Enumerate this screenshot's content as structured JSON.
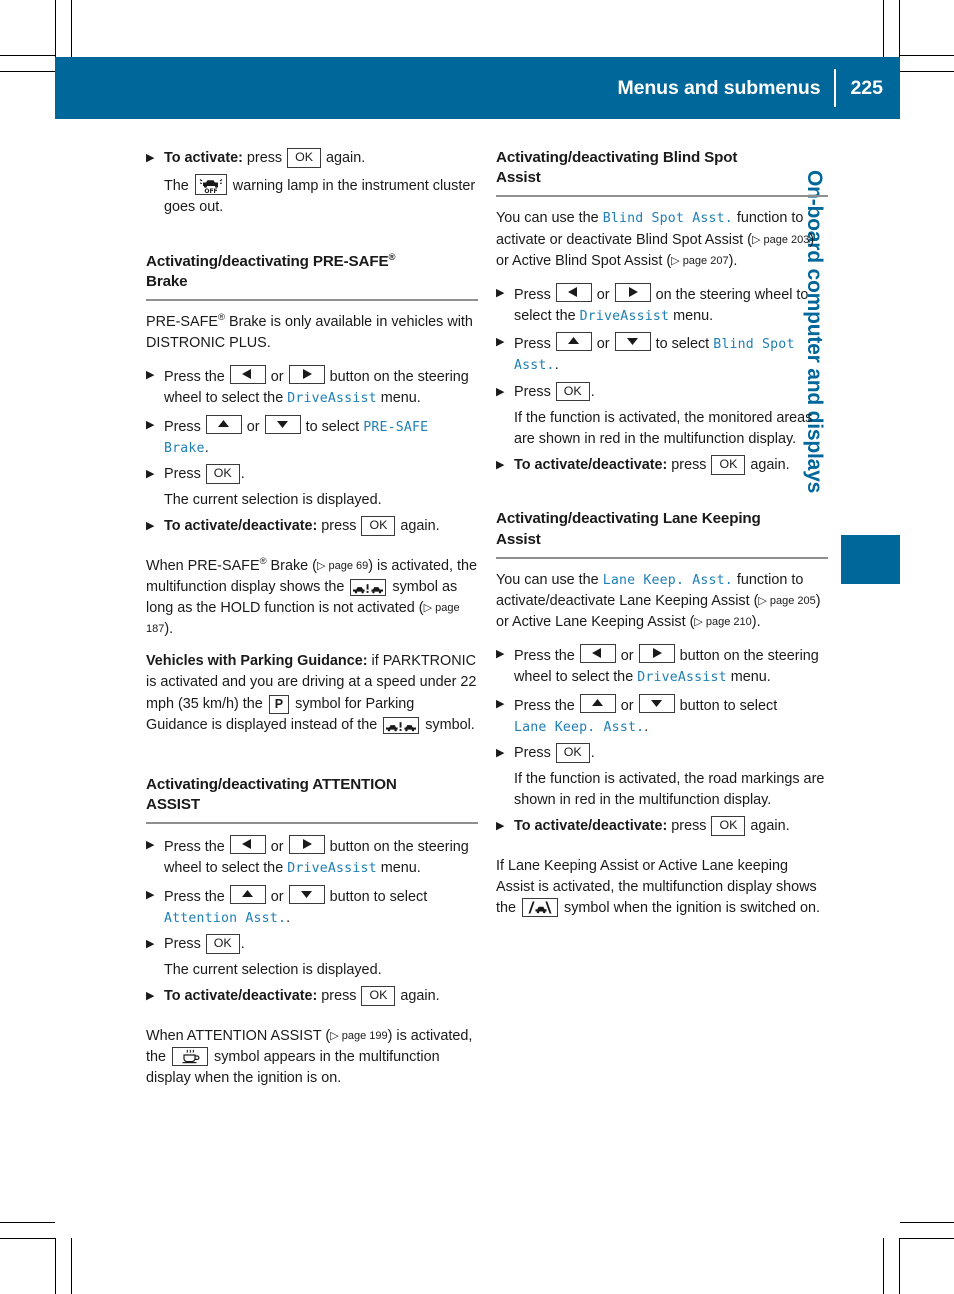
{
  "header": {
    "title": "Menus and submenus",
    "page_number": "225",
    "bar_color": "#00679a"
  },
  "side_tab": {
    "label": "On-board computer and displays",
    "color": "#00679a"
  },
  "keys": {
    "ok": "OK",
    "left": "left-arrow",
    "right": "right-arrow",
    "up": "up-arrow",
    "down": "down-arrow"
  },
  "left_column": {
    "step_activate": {
      "bold": "To activate:",
      "text_before": " press ",
      "text_after": " again."
    },
    "step_activate_sub_a": "The ",
    "step_activate_sub_b": " warning lamp in the instrument cluster goes out.",
    "presafe_section": {
      "heading_a": "Activating/deactivating PRE-SAFE",
      "heading_reg": "®",
      "heading_b": "Brake",
      "intro_a": "PRE-SAFE",
      "intro_reg": "®",
      "intro_b": " Brake is only available in vehicles with DISTRONIC PLUS.",
      "step1_a": "Press the ",
      "step1_b": " or ",
      "step1_c": " button on the steering wheel to select the ",
      "step1_menu": "DriveAssist",
      "step1_d": " menu.",
      "step2_a": "Press ",
      "step2_b": " or ",
      "step2_c": " to select ",
      "step2_menu": "PRE-SAFE Brake",
      "step2_d": ".",
      "step3_a": "Press ",
      "step3_b": ".",
      "step3_sub": "The current selection is displayed.",
      "step4_bold": "To activate/deactivate:",
      "step4_a": " press ",
      "step4_b": " again.",
      "note_a": "When PRE-SAFE",
      "note_reg": "®",
      "note_b": " Brake (",
      "note_ref1": "▷ page 69",
      "note_c": ") is activated, the multifunction display shows the ",
      "note_d": " symbol as long as the HOLD function is not activated (",
      "note_ref2": "▷ page 187",
      "note_e": ").",
      "parking_bold": "Vehicles with Parking Guidance:",
      "parking_a": " if PARKTRONIC is activated and you are driving at a speed under 22 mph (35 km/h) the ",
      "parking_p": "P",
      "parking_b": " symbol for Parking Guidance is displayed instead of the ",
      "parking_c": " symbol."
    },
    "attention_section": {
      "heading_a": "Activating/deactivating ATTENTION",
      "heading_b": "ASSIST",
      "step1_a": "Press the ",
      "step1_b": " or ",
      "step1_c": " button on the steering wheel to select the ",
      "step1_menu": "DriveAssist",
      "step1_d": " menu.",
      "step2_a": "Press the ",
      "step2_b": " or ",
      "step2_c": " button to select ",
      "step2_menu": "Attention Asst.",
      "step2_d": ".",
      "step3_a": "Press ",
      "step3_b": ".",
      "step3_sub": "The current selection is displayed.",
      "step4_bold": "To activate/deactivate:",
      "step4_a": " press ",
      "step4_b": " again.",
      "note_a": "When ATTENTION ASSIST (",
      "note_ref": "▷ page 199",
      "note_b": ") is activated, the ",
      "note_c": " symbol appears in the multifunction display when the ignition is on."
    }
  },
  "right_column": {
    "blind_spot_section": {
      "heading_a": "Activating/deactivating Blind Spot",
      "heading_b": "Assist",
      "intro_a": "You can use the ",
      "intro_menu": "Blind Spot Asst.",
      "intro_b": " function to activate or deactivate Blind Spot Assist (",
      "intro_ref1": "▷ page 203",
      "intro_c": ") or Active Blind Spot Assist (",
      "intro_ref2": "▷ page 207",
      "intro_d": ").",
      "step1_a": "Press ",
      "step1_b": " or ",
      "step1_c": " on the steering wheel to select the ",
      "step1_menu": "DriveAssist",
      "step1_d": " menu.",
      "step2_a": "Press ",
      "step2_b": " or ",
      "step2_c": " to select ",
      "step2_menu": "Blind Spot Asst.",
      "step2_d": ".",
      "step3_a": "Press ",
      "step3_b": ".",
      "step3_sub": "If the function is activated, the monitored areas are shown in red in the multifunction display.",
      "step4_bold": "To activate/deactivate:",
      "step4_a": " press ",
      "step4_b": " again."
    },
    "lane_keeping_section": {
      "heading_a": "Activating/deactivating Lane Keeping",
      "heading_b": "Assist",
      "intro_a": "You can use the ",
      "intro_menu": "Lane Keep. Asst.",
      "intro_b": " function to activate/deactivate Lane Keeping Assist (",
      "intro_ref1": "▷ page 205",
      "intro_c": ") or Active Lane Keeping Assist (",
      "intro_ref2": "▷ page 210",
      "intro_d": ").",
      "step1_a": "Press the ",
      "step1_b": " or ",
      "step1_c": " button on the steering wheel to select the ",
      "step1_menu": "DriveAssist",
      "step1_d": " menu.",
      "step2_a": "Press the ",
      "step2_b": " or ",
      "step2_c": " button to select ",
      "step2_menu": "Lane Keep. Asst.",
      "step2_d": ".",
      "step3_a": "Press ",
      "step3_b": ".",
      "step3_sub": "If the function is activated, the road markings are shown in red in the multifunction display.",
      "step4_bold": "To activate/deactivate:",
      "step4_a": " press ",
      "step4_b": " again.",
      "note": "If Lane Keeping Assist or Active Lane keeping Assist is activated, the multifunction display shows the ",
      "note_b": " symbol when the ignition is switched on."
    }
  },
  "symbols": {
    "presafe_brake_off_lamp": "presafe-brake-off-warning-lamp",
    "presafe_distance_warning": "presafe-distance-warning-symbol",
    "parking_guidance": "P",
    "attention_assist_cup": "coffee-cup-symbol",
    "lane_keeping": "lane-keeping-symbol"
  }
}
